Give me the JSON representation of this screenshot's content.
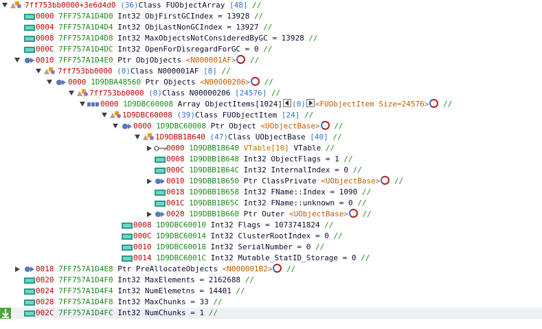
{
  "rows": [
    {
      "text_addr": "7ff753bb0000+3e6d4d0",
      "text_cnt": "(36)",
      "text_rest": "Class FUObjectArray",
      "text_val": "[48]",
      "text_cmt": "//"
    },
    {
      "off": "0000",
      "addr": "7FF757A1D4D0",
      "type": "Int32",
      "name": "ObjFirstGCIndex = 13928",
      "cmt": "//"
    },
    {
      "off": "0004",
      "addr": "7FF757A1D4D4",
      "type": "Int32",
      "name": "ObjLastNonGCIndex = 13927",
      "cmt": "//"
    },
    {
      "off": "0008",
      "addr": "7FF757A1D4D8",
      "type": "Int32",
      "name": "MaxObjectsNotConsideredByGC = 13928",
      "cmt": "//"
    },
    {
      "off": "000C",
      "addr": "7FF757A1D4DC",
      "type": "Int32",
      "name": "OpenForDisregardForGC = 0",
      "cmt": "//"
    },
    {
      "off": "0010",
      "addr": "7FF757A1D4E0",
      "type": "Ptr",
      "name": "ObjObjects",
      "ref": "<N000001AF>",
      "cmt": "//"
    },
    {
      "text_addr": "7ff753bb0000",
      "text_cnt": "(0)",
      "text_rest": "Class N000001AF",
      "text_val": "[8]",
      "text_cmt": "//"
    },
    {
      "off": "0000",
      "addr": "1D9DBA48560",
      "type": "Ptr",
      "name": "Objects",
      "ref": "<N00000206>",
      "cmt": "//"
    },
    {
      "text_addr": "7ff753bb0000",
      "text_cnt": "(0)",
      "text_rest": "Class N00000206",
      "text_val": "[24576]",
      "text_cmt": "//"
    },
    {
      "off": "0000",
      "addr": "1D9DBC60008",
      "type": "Array",
      "name": "ObjectItems[1024]",
      "cnt": "(0)",
      "ref": "<FUObjectItem Size=24576>",
      "cmt": "//"
    },
    {
      "text_addr": "1D9DBC60008",
      "text_cnt": "(39)",
      "text_rest": "Class FUObjectItem",
      "text_val": "[24]",
      "text_cmt": "//"
    },
    {
      "off": "0000",
      "addr": "1D9DBC60008",
      "type": "Ptr",
      "name": "Object",
      "ref": "<UObjectBase>",
      "cmt": "//"
    },
    {
      "text_addr": "1D9DBB1B640",
      "text_cnt": "(47)",
      "text_rest": "Class UObjectBase",
      "text_val": "[40]",
      "text_cmt": "//"
    },
    {
      "off": "0000",
      "addr": "1D9DBB1B640",
      "type": "VTable[10]",
      "name": "VTable",
      "cmt": "//"
    },
    {
      "off": "0008",
      "addr": "1D9DBB1B648",
      "type": "Int32",
      "name": "ObjectFlags = 1",
      "cmt": "//"
    },
    {
      "off": "000C",
      "addr": "1D9DBB1B64C",
      "type": "Int32",
      "name": "InternalIndex = 0",
      "cmt": "//"
    },
    {
      "off": "0010",
      "addr": "1D9DBB1B650",
      "type": "Ptr",
      "name": "ClassPrivate",
      "ref": "<UObjectBase>",
      "cmt": "//"
    },
    {
      "off": "0018",
      "addr": "1D9DBB1B658",
      "type": "Int32",
      "name": "FName::Index = 1090",
      "cmt": "//"
    },
    {
      "off": "001C",
      "addr": "1D9DBB1B65C",
      "type": "Int32",
      "name": "FName::unknown = 0",
      "cmt": "//"
    },
    {
      "off": "0020",
      "addr": "1D9DBB1B660",
      "type": "Ptr",
      "name": "Outer",
      "ref": "<UObjectBase>",
      "cmt": "//"
    },
    {
      "off": "0008",
      "addr": "1D9DBC60010",
      "type": "Int32",
      "name": "Flags = 1073741824",
      "cmt": "//"
    },
    {
      "off": "000C",
      "addr": "1D9DBC60014",
      "type": "Int32",
      "name": "ClusterRootIndex = 0",
      "cmt": "//"
    },
    {
      "off": "0010",
      "addr": "1D9DBC60018",
      "type": "Int32",
      "name": "SerialNumber = 0",
      "cmt": "//"
    },
    {
      "off": "0014",
      "addr": "1D9DBC6001C",
      "type": "Int32",
      "name": "Mutable_StatID_Storage = 0",
      "cmt": "//"
    },
    {
      "off": "0018",
      "addr": "7FF757A1D4E8",
      "type": "Ptr",
      "name": "PreAllocateObjects",
      "ref": "<N000001B2>",
      "cmt": "//"
    },
    {
      "off": "0020",
      "addr": "7FF757A1D4F0",
      "type": "Int32",
      "name": "MaxElements = 2162688",
      "cmt": "//"
    },
    {
      "off": "0024",
      "addr": "7FF757A1D4F4",
      "type": "Int32",
      "name": "NumElemetns = 14401",
      "cmt": "//"
    },
    {
      "off": "0028",
      "addr": "7FF757A1D4F8",
      "type": "Int32",
      "name": "MaxChunks = 33",
      "cmt": "//"
    },
    {
      "off": "002C",
      "addr": "7FF757A1D4FC",
      "type": "Int32",
      "name": "NumChunks = 1",
      "cmt": "//"
    }
  ]
}
